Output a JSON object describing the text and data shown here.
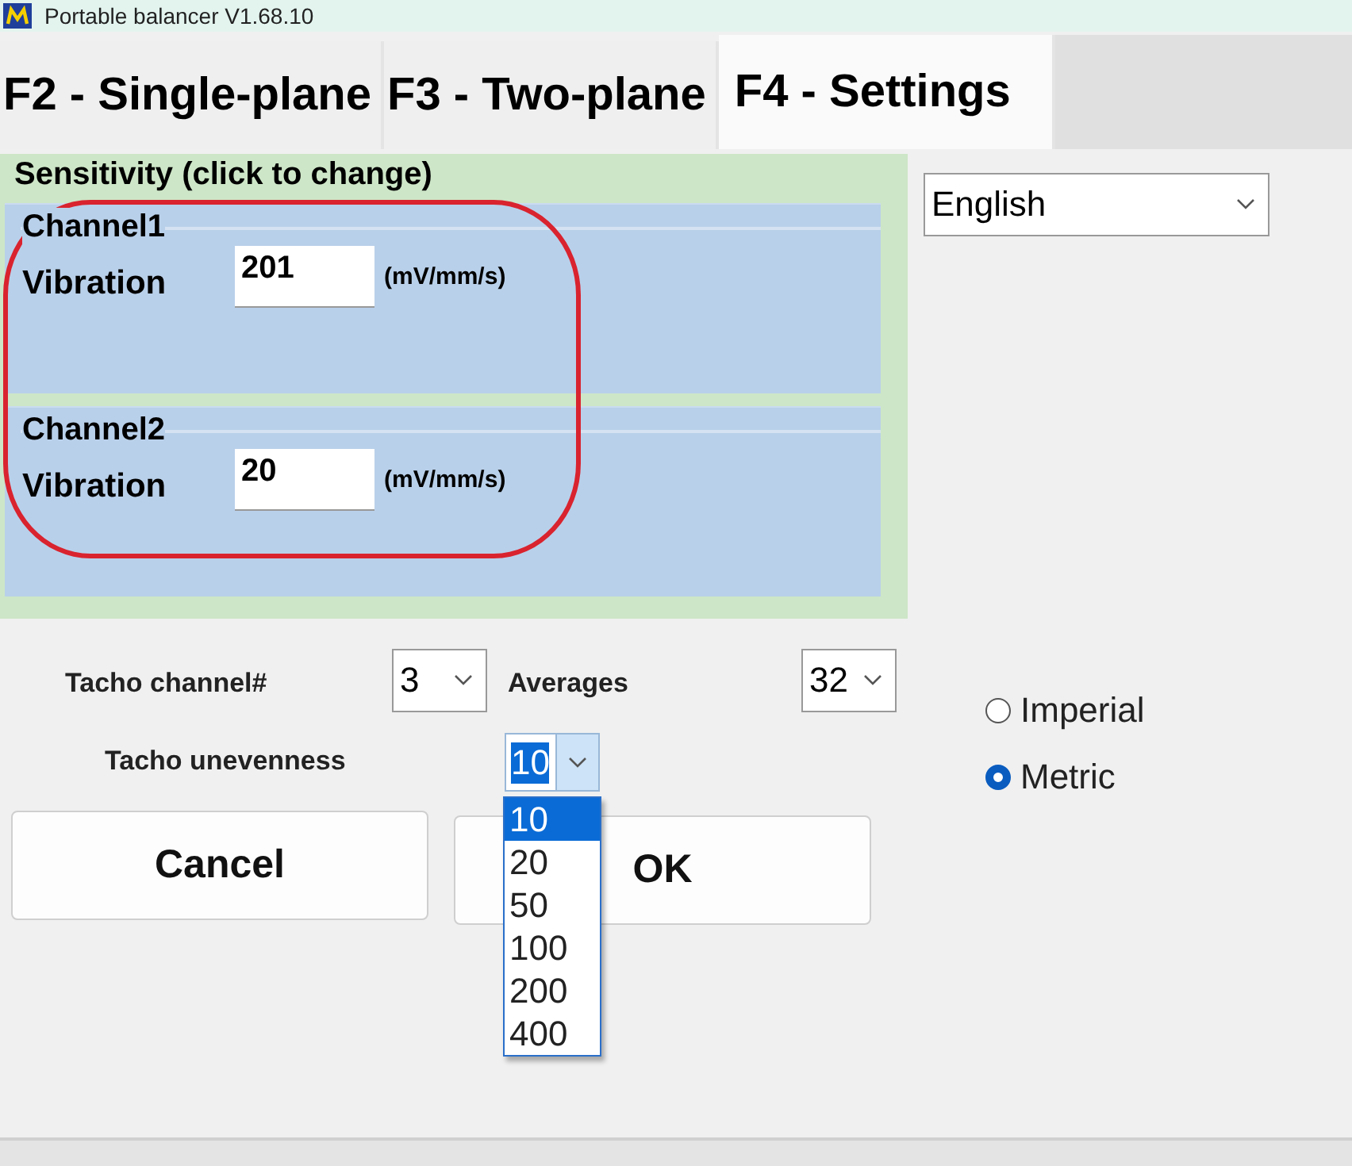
{
  "window": {
    "title": "Portable balancer V1.68.10"
  },
  "tabs": [
    {
      "label": "F2 - Single-plane",
      "selected": false
    },
    {
      "label": "F3 - Two-plane",
      "selected": false
    },
    {
      "label": "F4 - Settings",
      "selected": true
    }
  ],
  "sensitivity": {
    "title": "Sensitivity (click to change)",
    "highlighted": true,
    "channels": [
      {
        "name": "Channel1",
        "label": "Vibration",
        "value": "201",
        "unit": "(mV/mm/s)"
      },
      {
        "name": "Channel2",
        "label": "Vibration",
        "value": "20",
        "unit": "(mV/mm/s)"
      }
    ]
  },
  "language": {
    "value": "English"
  },
  "tacho_channel": {
    "label": "Tacho channel#",
    "value": "3"
  },
  "averages": {
    "label": "Averages",
    "value": "32"
  },
  "tacho_unevenness": {
    "label": "Tacho unevenness",
    "value": "10",
    "expanded": true,
    "options": [
      {
        "label": "10",
        "selected": true
      },
      {
        "label": "20",
        "selected": false
      },
      {
        "label": "50",
        "selected": false
      },
      {
        "label": "100",
        "selected": false
      },
      {
        "label": "200",
        "selected": false
      },
      {
        "label": "400",
        "selected": false
      }
    ]
  },
  "units": [
    {
      "label": "Imperial",
      "selected": false
    },
    {
      "label": "Metric",
      "selected": true
    }
  ],
  "buttons": [
    {
      "label": "Cancel"
    },
    {
      "label": "OK"
    }
  ]
}
